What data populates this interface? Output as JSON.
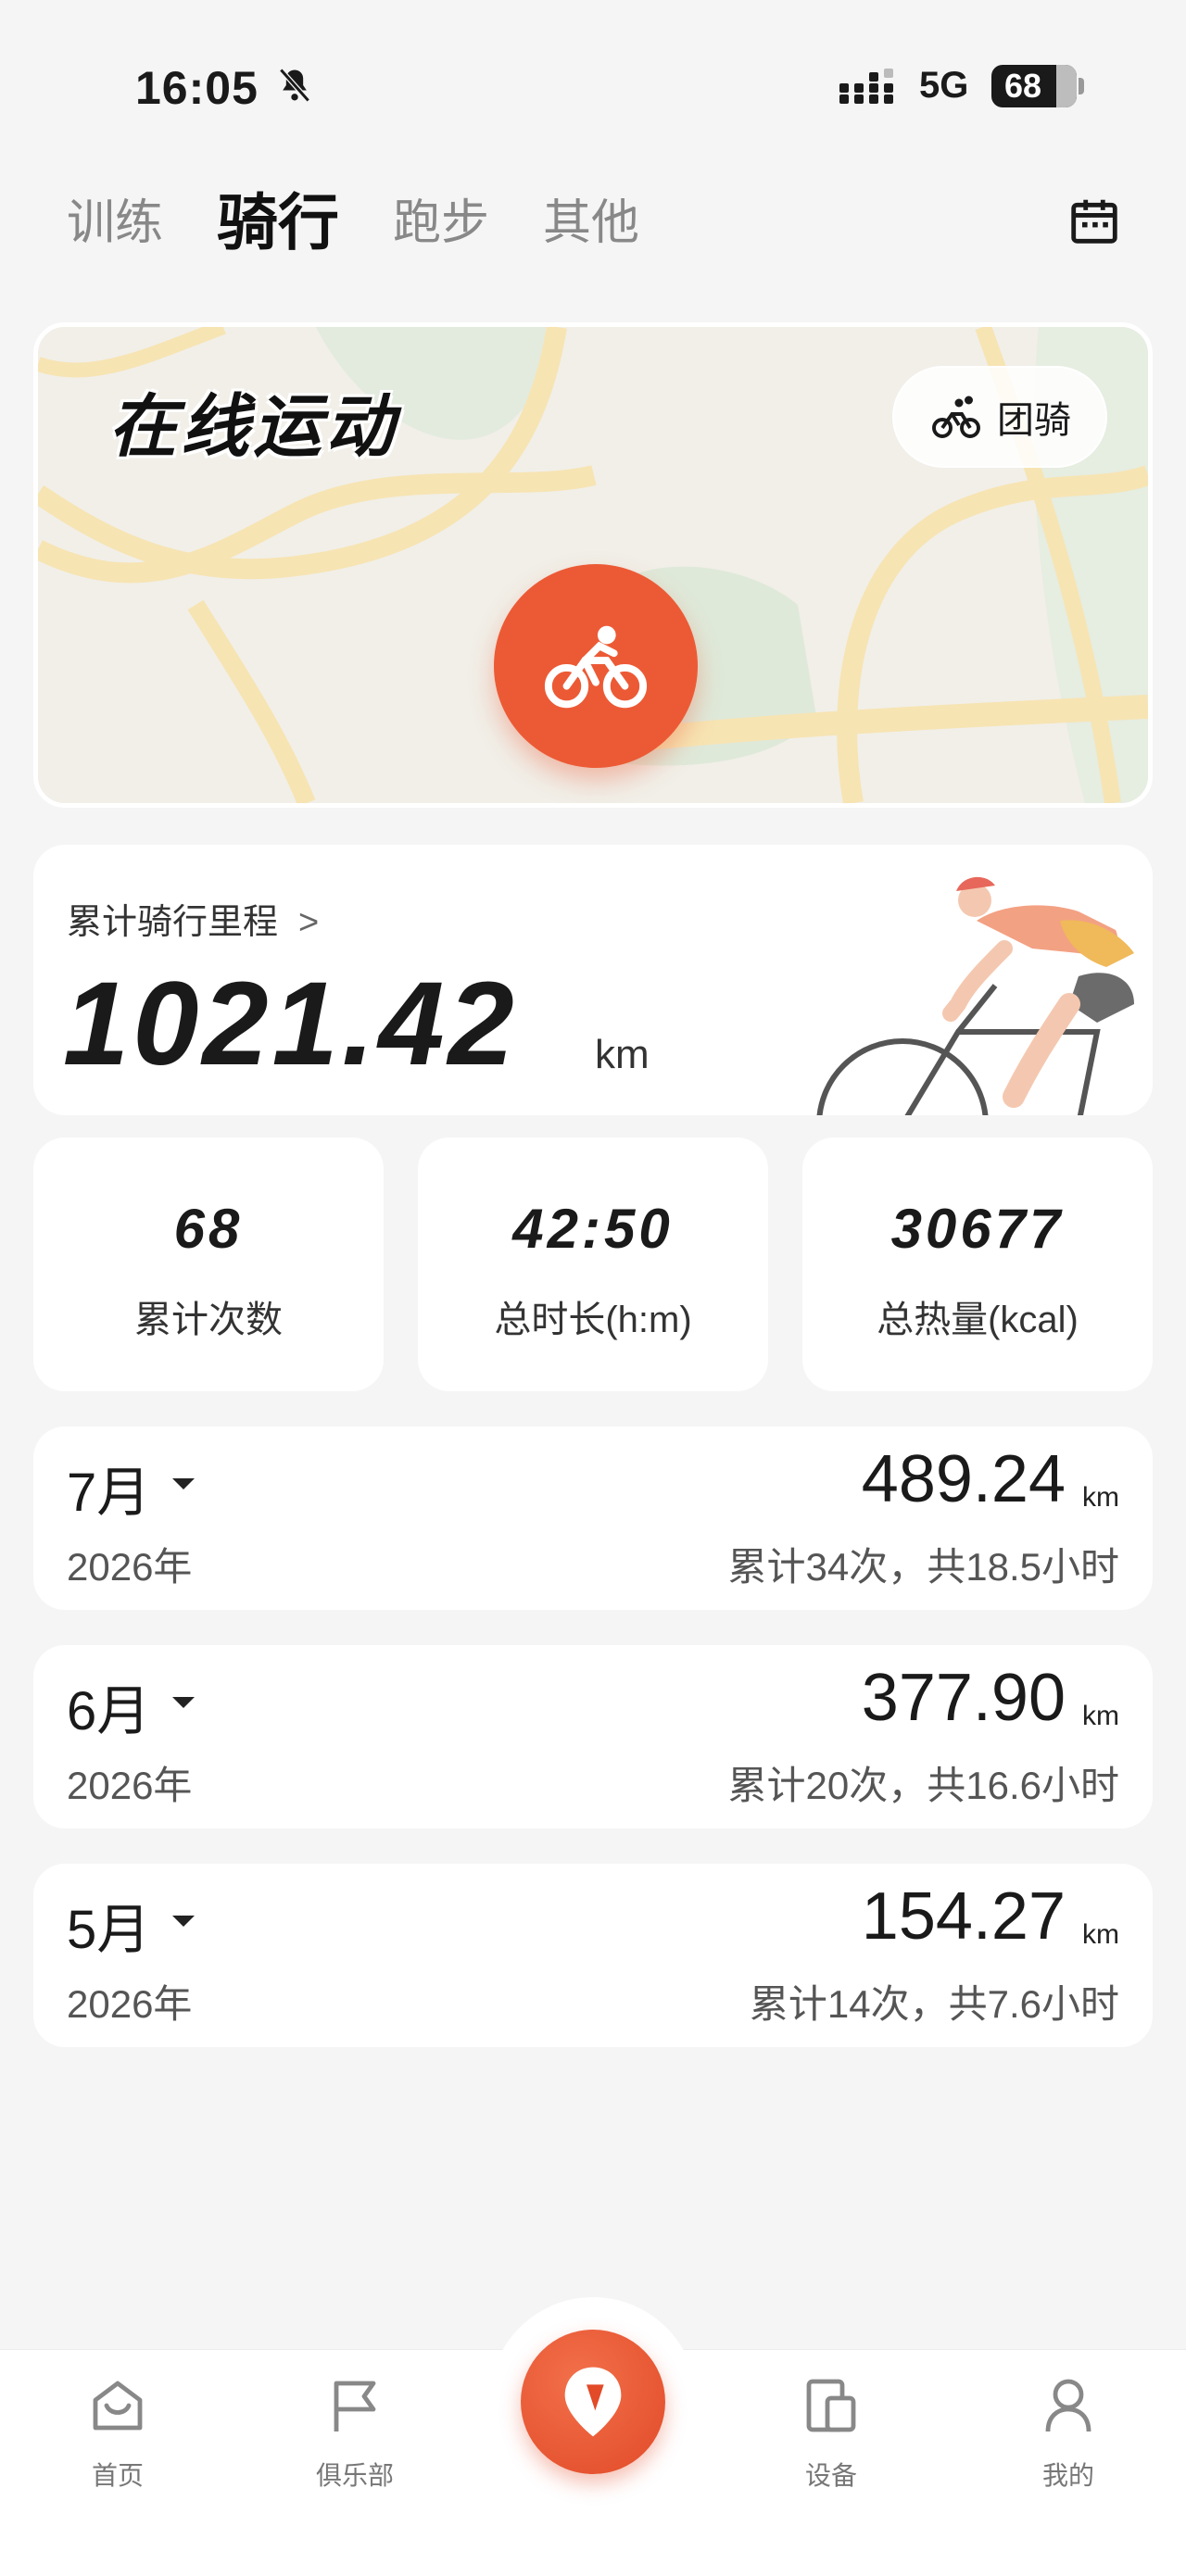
{
  "status_bar": {
    "time": "16:05",
    "network": "5G",
    "battery": "68"
  },
  "tabs": [
    {
      "label": "训练"
    },
    {
      "label": "骑行",
      "active": true
    },
    {
      "label": "跑步"
    },
    {
      "label": "其他"
    }
  ],
  "map_card": {
    "title": "在线运动",
    "group_ride_label": "团骑"
  },
  "mileage": {
    "label": "累计骑行里程",
    "value": "1021.42",
    "unit": "km"
  },
  "stats": [
    {
      "value": "68",
      "label": "累计次数"
    },
    {
      "value": "42:50",
      "label": "总时长(h:m)"
    },
    {
      "value": "30677",
      "label": "总热量(kcal)"
    }
  ],
  "months": [
    {
      "month": "7月",
      "year": "2026年",
      "distance": "489.24",
      "unit": "km",
      "summary": "累计34次，共18.5小时"
    },
    {
      "month": "6月",
      "year": "2026年",
      "distance": "377.90",
      "unit": "km",
      "summary": "累计20次，共16.6小时"
    },
    {
      "month": "5月",
      "year": "2026年",
      "distance": "154.27",
      "unit": "km",
      "summary": "累计14次，共7.6小时"
    }
  ],
  "bottom_nav": {
    "home": "首页",
    "club": "俱乐部",
    "device": "设备",
    "mine": "我的"
  },
  "colors": {
    "accent": "#ec5a35",
    "background": "#f5f5f5",
    "card": "#ffffff"
  }
}
